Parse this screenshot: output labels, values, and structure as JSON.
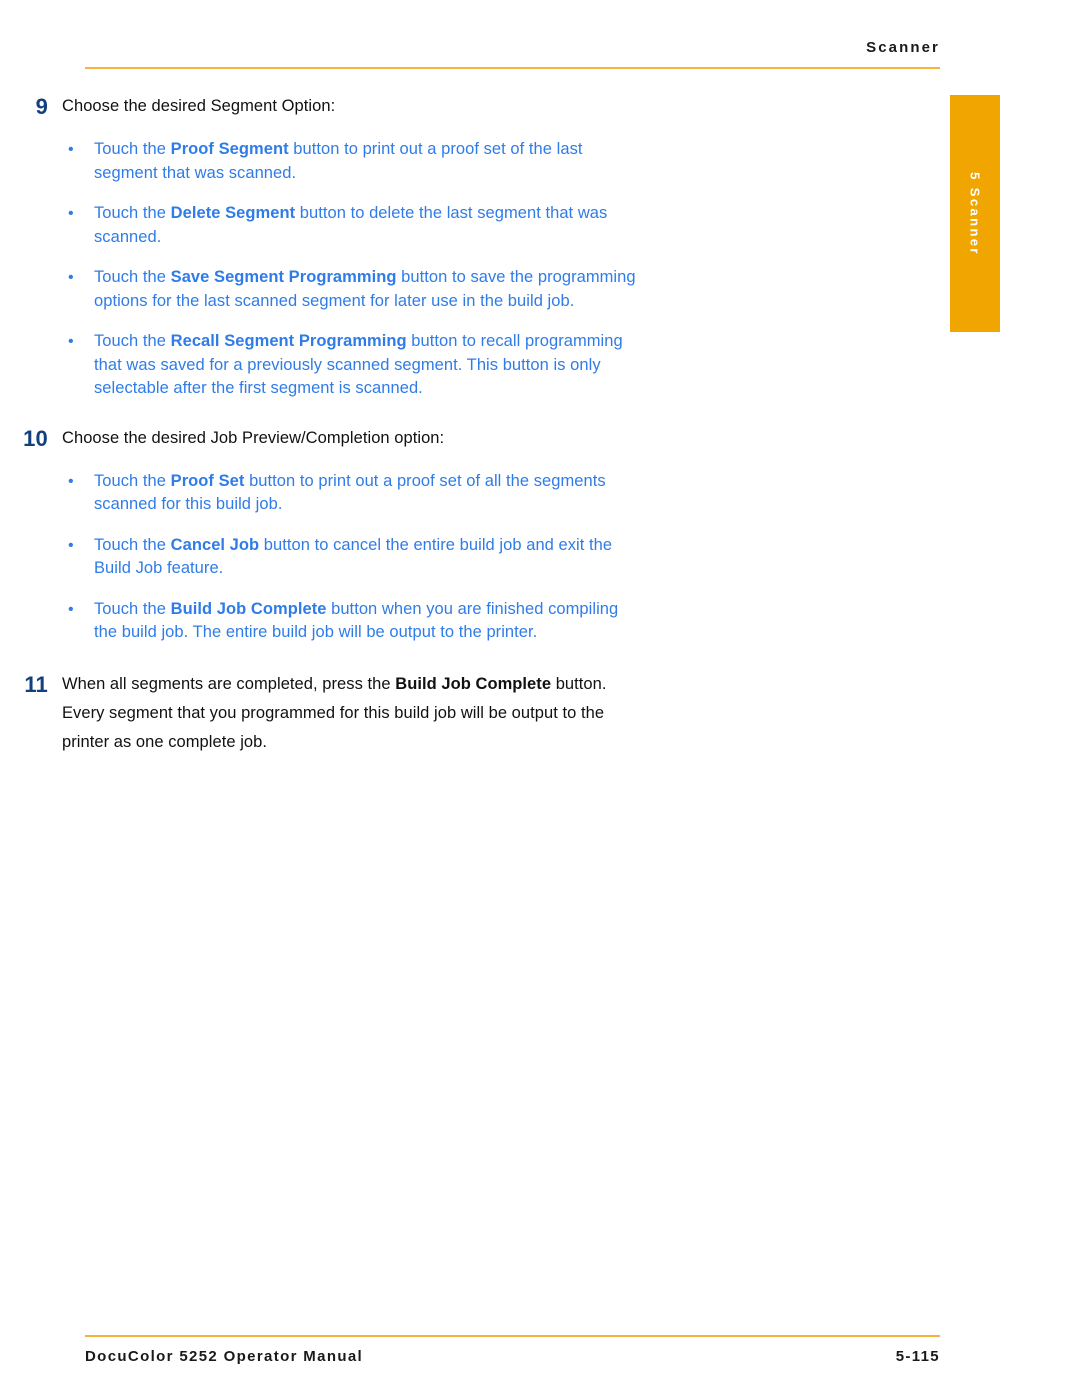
{
  "document": {
    "header_title": "Scanner",
    "chapter_tab_label": "5 Scanner",
    "footer_left": "DocuColor 5252 Operator Manual",
    "footer_right": "5-115",
    "colors": {
      "rule_orange": "#f7b43c",
      "tab_orange": "#f0a500",
      "step_number_navy": "#123f7e",
      "bullet_blue": "#2f7ce8",
      "body_black": "#111111"
    }
  },
  "steps": [
    {
      "number": "9",
      "text_parts": [
        {
          "t": "Choose the desired Segment Option:",
          "b": false
        }
      ],
      "bullets": [
        {
          "mark": "•",
          "parts": [
            {
              "t": "Touch the ",
              "b": false
            },
            {
              "t": "Proof Segment",
              "b": true
            },
            {
              "t": " button to print out a proof set of the last segment that was scanned.",
              "b": false
            }
          ]
        },
        {
          "mark": "•",
          "parts": [
            {
              "t": "Touch the ",
              "b": false
            },
            {
              "t": "Delete Segment",
              "b": true
            },
            {
              "t": " button to delete the last segment that was scanned.",
              "b": false
            }
          ]
        },
        {
          "mark": "•",
          "parts": [
            {
              "t": "Touch the ",
              "b": false
            },
            {
              "t": "Save Segment Programming",
              "b": true
            },
            {
              "t": " button to save the programming options for the last scanned segment for later use in the build job.",
              "b": false
            }
          ]
        },
        {
          "mark": "•",
          "parts": [
            {
              "t": "Touch the ",
              "b": false
            },
            {
              "t": "Recall Segment Programming",
              "b": true
            },
            {
              "t": " button to recall programming that was saved for a previously scanned segment. This button is only selectable after the first segment is scanned.",
              "b": false
            }
          ]
        }
      ]
    },
    {
      "number": "10",
      "text_parts": [
        {
          "t": "Choose the desired Job Preview/Completion option:",
          "b": false
        }
      ],
      "bullets": [
        {
          "mark": "•",
          "parts": [
            {
              "t": "Touch the ",
              "b": false
            },
            {
              "t": "Proof Set",
              "b": true
            },
            {
              "t": " button to print out a proof set of all the segments scanned for this build job.",
              "b": false
            }
          ]
        },
        {
          "mark": "•",
          "parts": [
            {
              "t": "Touch the ",
              "b": false
            },
            {
              "t": "Cancel Job",
              "b": true
            },
            {
              "t": " button to cancel the entire build job and exit the Build Job feature.",
              "b": false
            }
          ]
        },
        {
          "mark": "•",
          "parts": [
            {
              "t": "Touch the ",
              "b": false
            },
            {
              "t": "Build Job Complete",
              "b": true
            },
            {
              "t": " button when you are finished compiling the build job. The entire build job will be output to the printer.",
              "b": false
            }
          ]
        }
      ]
    },
    {
      "number": "11",
      "text_parts": [
        {
          "t": "When all segments are completed, press the ",
          "b": false
        },
        {
          "t": "Build Job Complete",
          "b": true
        },
        {
          "t": " button. Every segment that you programmed for this build job will be output to the printer as one complete job.",
          "b": false
        }
      ],
      "bullets": []
    }
  ]
}
